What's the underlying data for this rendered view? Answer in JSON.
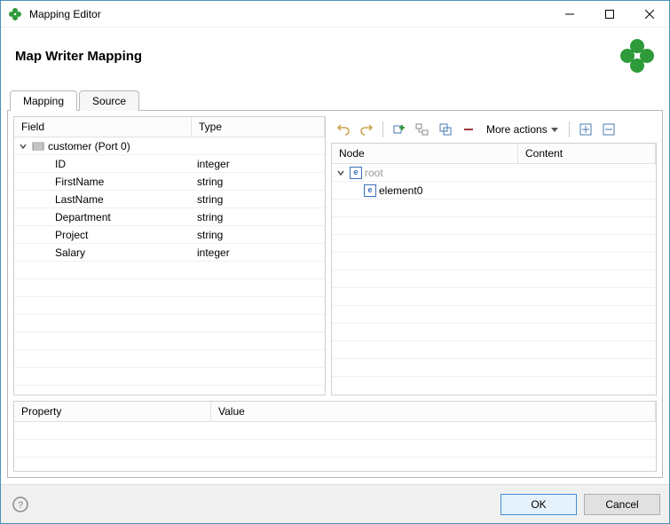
{
  "window": {
    "title": "Mapping Editor"
  },
  "header": {
    "title": "Map Writer Mapping"
  },
  "tabs": [
    {
      "label": "Mapping",
      "active": true
    },
    {
      "label": "Source",
      "active": false
    }
  ],
  "left": {
    "headers": {
      "field": "Field",
      "type": "Type"
    },
    "root": {
      "label": "customer (Port 0)"
    },
    "rows": [
      {
        "field": "ID",
        "type": "integer"
      },
      {
        "field": "FirstName",
        "type": "string"
      },
      {
        "field": "LastName",
        "type": "string"
      },
      {
        "field": "Department",
        "type": "string"
      },
      {
        "field": "Project",
        "type": "string"
      },
      {
        "field": "Salary",
        "type": "integer"
      }
    ]
  },
  "right": {
    "toolbar": {
      "more_label": "More actions"
    },
    "headers": {
      "node": "Node",
      "content": "Content"
    },
    "root": {
      "label": "root",
      "badge": "e"
    },
    "children": [
      {
        "label": "element0",
        "badge": "e"
      }
    ]
  },
  "props": {
    "headers": {
      "property": "Property",
      "value": "Value"
    }
  },
  "footer": {
    "ok": "OK",
    "cancel": "Cancel"
  }
}
